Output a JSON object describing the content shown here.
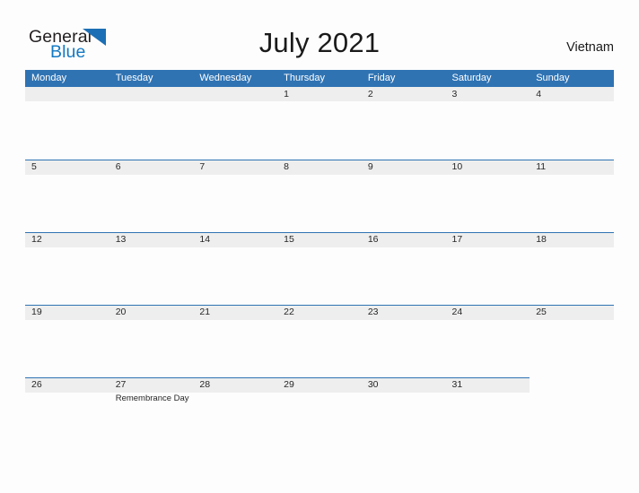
{
  "brand": {
    "name_part1": "General",
    "name_part2": "Blue",
    "triangle_color": "#1c6fb5",
    "text_color": "#231f20",
    "blue_color": "#1379c4"
  },
  "header": {
    "title": "July 2021",
    "country": "Vietnam"
  },
  "theme": {
    "header_blue": "#2f73b3",
    "band_gray": "#eeeeee",
    "page_background": "#fdfdfd",
    "text": "#262626"
  },
  "calendar": {
    "weekdays": [
      "Monday",
      "Tuesday",
      "Wednesday",
      "Thursday",
      "Friday",
      "Saturday",
      "Sunday"
    ],
    "weeks": [
      {
        "band_columns": 7,
        "days": [
          {
            "num": "",
            "event": ""
          },
          {
            "num": "",
            "event": ""
          },
          {
            "num": "",
            "event": ""
          },
          {
            "num": "1",
            "event": ""
          },
          {
            "num": "2",
            "event": ""
          },
          {
            "num": "3",
            "event": ""
          },
          {
            "num": "4",
            "event": ""
          }
        ]
      },
      {
        "band_columns": 7,
        "days": [
          {
            "num": "5",
            "event": ""
          },
          {
            "num": "6",
            "event": ""
          },
          {
            "num": "7",
            "event": ""
          },
          {
            "num": "8",
            "event": ""
          },
          {
            "num": "9",
            "event": ""
          },
          {
            "num": "10",
            "event": ""
          },
          {
            "num": "11",
            "event": ""
          }
        ]
      },
      {
        "band_columns": 7,
        "days": [
          {
            "num": "12",
            "event": ""
          },
          {
            "num": "13",
            "event": ""
          },
          {
            "num": "14",
            "event": ""
          },
          {
            "num": "15",
            "event": ""
          },
          {
            "num": "16",
            "event": ""
          },
          {
            "num": "17",
            "event": ""
          },
          {
            "num": "18",
            "event": ""
          }
        ]
      },
      {
        "band_columns": 7,
        "days": [
          {
            "num": "19",
            "event": ""
          },
          {
            "num": "20",
            "event": ""
          },
          {
            "num": "21",
            "event": ""
          },
          {
            "num": "22",
            "event": ""
          },
          {
            "num": "23",
            "event": ""
          },
          {
            "num": "24",
            "event": ""
          },
          {
            "num": "25",
            "event": ""
          }
        ]
      },
      {
        "band_columns": 7,
        "days": [
          {
            "num": "26",
            "event": ""
          },
          {
            "num": "27",
            "event": "Remembrance Day"
          },
          {
            "num": "28",
            "event": ""
          },
          {
            "num": "29",
            "event": ""
          },
          {
            "num": "30",
            "event": ""
          },
          {
            "num": "31",
            "event": ""
          },
          {
            "num": "",
            "event": ""
          }
        ]
      }
    ]
  }
}
